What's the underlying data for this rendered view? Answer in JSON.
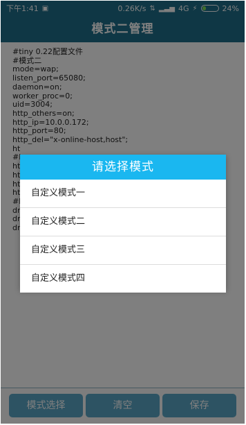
{
  "status_bar": {
    "time": "下午1:41",
    "net_speed": "0.26K/s",
    "network": "4G",
    "battery": "24%",
    "battery_level": 0.24
  },
  "header": {
    "title": "模式二管理"
  },
  "config_lines": [
    "#tiny 0.22配置文件",
    "#模式二",
    "mode=wap;",
    "listen_port=65080;",
    "daemon=on;",
    "worker_proc=0;",
    "uid=3004;",
    "http_others=on;",
    "http_ip=10.0.0.172;",
    "http_port=80;",
    "http_del=\"x-online-host,host\";",
    "ht",
    "#h",
    "ht",
    "ht",
    "ht",
    "ht",
    "#h",
    "dr",
    "dr",
    "dr"
  ],
  "dialog": {
    "title": "请选择模式",
    "items": [
      "自定义模式一",
      "自定义模式二",
      "自定义模式三",
      "自定义模式四"
    ]
  },
  "buttons": {
    "mode_select": "模式选择",
    "clear": "清空",
    "save": "保存"
  },
  "colors": {
    "header": "#1e6f8a",
    "dialog_title": "#1ab7f0",
    "button": "#5aa7c7"
  }
}
